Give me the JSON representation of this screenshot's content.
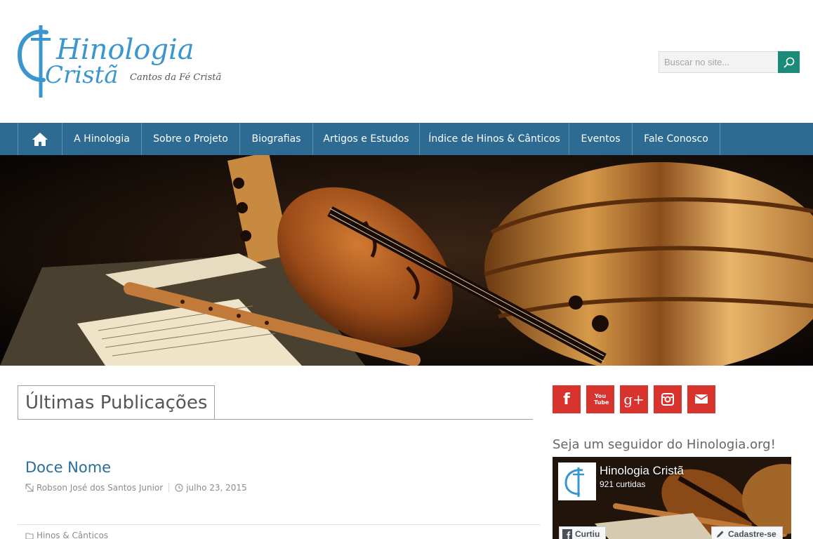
{
  "logo": {
    "line1": "Hinologia",
    "line2": "Cristã",
    "tagline": "Cantos da Fé Cristã",
    "color": "#3b96cf"
  },
  "search": {
    "placeholder": "Buscar no site...",
    "button_icon": "search-icon",
    "button_color": "#1b8a79"
  },
  "nav": {
    "home_icon": "home-icon",
    "items": [
      {
        "label": "A Hinologia"
      },
      {
        "label": "Sobre o Projeto"
      },
      {
        "label": "Biografias"
      },
      {
        "label": "Artigos e Estudos"
      },
      {
        "label": "Índice de Hinos & Cânticos"
      },
      {
        "label": "Eventos"
      },
      {
        "label": "Fale Conosco"
      }
    ],
    "color": "#2d6b93"
  },
  "slider": {
    "image": "violin-lute-recorder-sheet-music",
    "dots": 2,
    "active_dot": 1
  },
  "main": {
    "section_title": "Últimas Publicações",
    "post": {
      "title": "Doce Nome",
      "author": "Robson José dos Santos Junior",
      "date": "julho 23, 2015",
      "category": "Hinos & Cânticos"
    }
  },
  "sidebar": {
    "social": [
      {
        "icon": "facebook-icon",
        "glyph": "f"
      },
      {
        "icon": "youtube-icon",
        "glyph": "You Tube"
      },
      {
        "icon": "google-plus-icon",
        "glyph": "g+"
      },
      {
        "icon": "instagram-icon",
        "glyph": ""
      },
      {
        "icon": "email-icon",
        "glyph": ""
      }
    ],
    "social_color": "#d9332f",
    "follow_title": "Seja um seguidor do Hinologia.org!",
    "fb_widget": {
      "page_name": "Hinologia Cristã",
      "likes": "921 curtidas",
      "like_label": "Curtiu",
      "signup_label": "Cadastre-se"
    }
  }
}
